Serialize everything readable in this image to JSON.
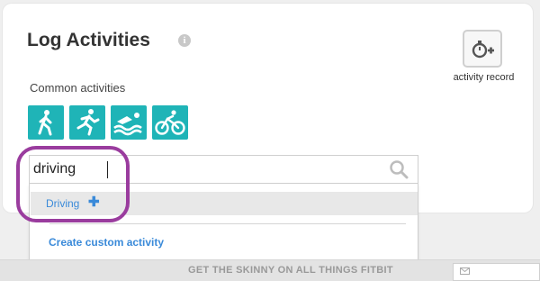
{
  "header": {
    "title": "Log Activities",
    "info_icon": "info-icon"
  },
  "record": {
    "label": "activity record",
    "icon": "stopwatch-plus-icon"
  },
  "common": {
    "label": "Common activities",
    "items": [
      {
        "name": "walk",
        "icon": "walk-icon"
      },
      {
        "name": "run",
        "icon": "run-icon"
      },
      {
        "name": "swim",
        "icon": "swim-icon"
      },
      {
        "name": "bike",
        "icon": "bike-icon"
      }
    ],
    "accent": "#1fb4b7"
  },
  "search": {
    "value": "driving",
    "icon": "search-icon"
  },
  "dropdown": {
    "result_label": "Driving",
    "add_symbol": "✚",
    "custom_label": "Create custom activity",
    "link_color": "#3a8ad9"
  },
  "highlight_color": "#9a3c9e",
  "footer": {
    "text": "GET THE SKINNY ON ALL THINGS FITBIT",
    "mail_icon": "mail-icon"
  }
}
